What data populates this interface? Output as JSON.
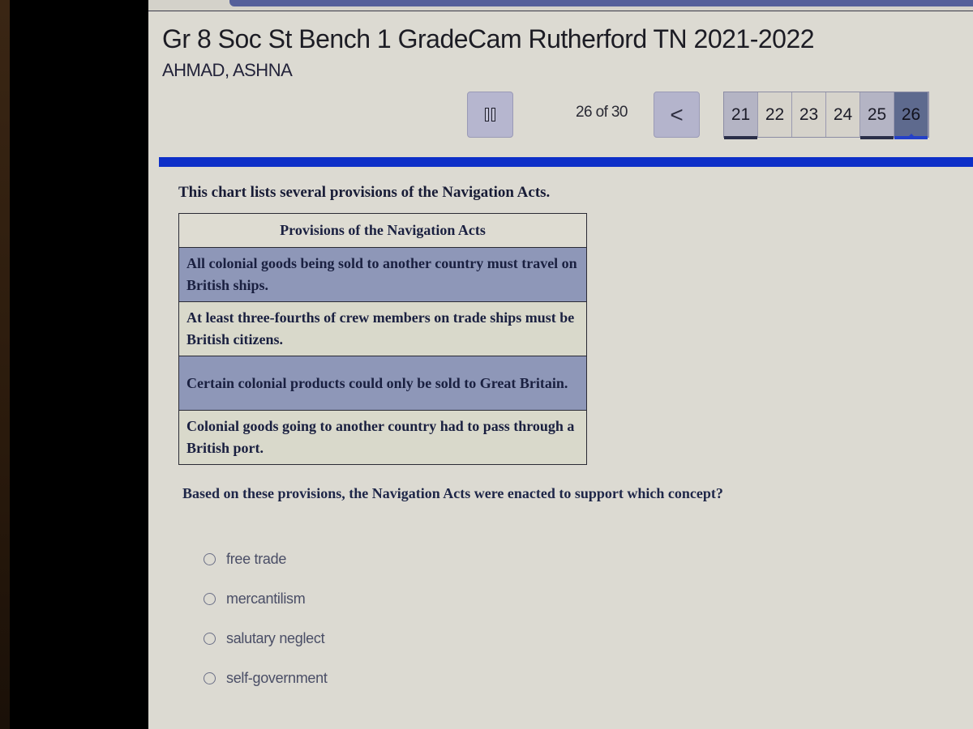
{
  "header": {
    "title": "Gr 8 Soc St Bench 1 GradeCam Rutherford TN 2021-2022",
    "student": "AHMAD, ASHNA"
  },
  "toolbar": {
    "pause_icon": "pause-icon",
    "counter": "26 of 30",
    "prev_label": "<",
    "progress_percent": 100
  },
  "pager": {
    "pages": [
      {
        "label": "21",
        "state": "answered"
      },
      {
        "label": "22",
        "state": "unanswered"
      },
      {
        "label": "23",
        "state": "unanswered"
      },
      {
        "label": "24",
        "state": "unanswered"
      },
      {
        "label": "25",
        "state": "answered"
      },
      {
        "label": "26",
        "state": "current"
      }
    ]
  },
  "question": {
    "intro": "This chart lists several provisions of the Navigation Acts.",
    "table": {
      "header": "Provisions of the Navigation Acts",
      "rows": [
        "All colonial goods being sold to another country must travel on British ships.",
        "At least three-fourths of crew members on trade ships must be British citizens.",
        "Certain colonial products could only be sold to Great Britain.",
        "Colonial goods going to another country had to pass through a British port."
      ]
    },
    "stem": "Based on these provisions, the Navigation Acts were enacted to support which concept?",
    "choices": [
      {
        "label": "free trade",
        "selected": false
      },
      {
        "label": "mercantilism",
        "selected": false
      },
      {
        "label": "salutary neglect",
        "selected": false
      },
      {
        "label": "self-government",
        "selected": false
      }
    ]
  },
  "colors": {
    "progress_bar": "#0d2fc8",
    "table_shaded_row": "#8e97b8",
    "current_page": "#5e6a8e"
  }
}
